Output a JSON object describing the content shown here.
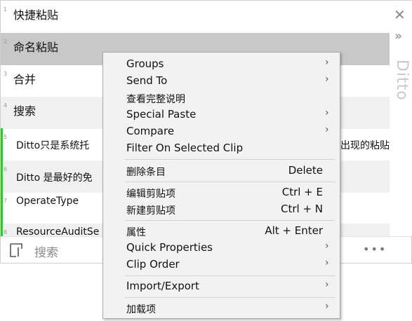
{
  "clips": [
    {
      "num": "1",
      "text": "快捷粘贴"
    },
    {
      "num": "2",
      "text": "命名粘贴"
    },
    {
      "num": "3",
      "text": "合并"
    },
    {
      "num": "4",
      "text": "搜索"
    },
    {
      "num": "5",
      "text": "Ditto只是系统托",
      "tail": "出现的粘贴"
    },
    {
      "num": "6",
      "text": "Ditto 是最好的免"
    },
    {
      "num": "7",
      "text": "OperateType"
    },
    {
      "num": "8",
      "text": "ResourceAuditSe"
    }
  ],
  "sidebar": {
    "close_glyph": "✕",
    "expand_glyph": "»",
    "brand": "Ditto"
  },
  "bottom": {
    "search_label": "搜索",
    "more_glyph": "•••"
  },
  "menu": {
    "groups": "Groups",
    "send_to": "Send To",
    "view_full": "查看完整说明",
    "special_paste": "Special Paste",
    "compare": "Compare",
    "filter_on_selected": "Filter On Selected Clip",
    "delete_entry": "删除条目",
    "delete_shortcut": "Delete",
    "edit_clip": "编辑剪贴项",
    "edit_shortcut": "Ctrl + E",
    "new_clip": "新建剪贴项",
    "new_shortcut": "Ctrl + N",
    "properties": "属性",
    "properties_shortcut": "Alt + Enter",
    "quick_properties": "Quick Properties",
    "clip_order": "Clip Order",
    "import_export": "Import/Export",
    "addons": "加载项",
    "arrow_glyph": "›"
  }
}
